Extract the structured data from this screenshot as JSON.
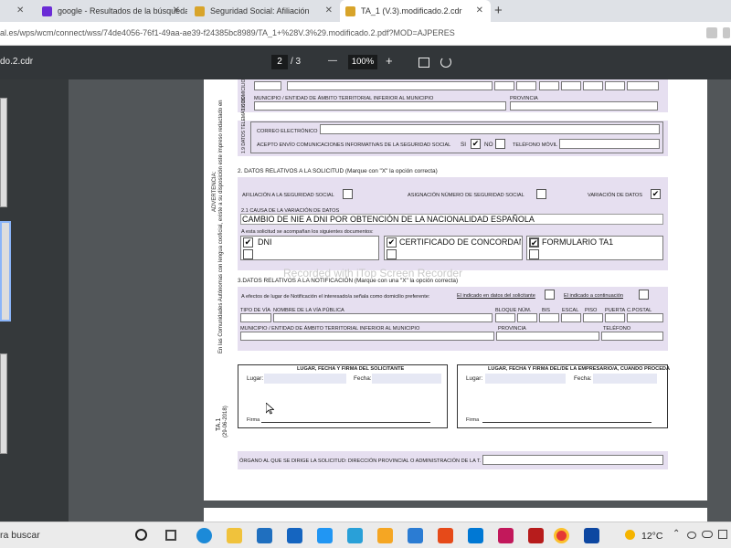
{
  "browser": {
    "tabs": [
      {
        "label": "google - Resultados de la búsqueda",
        "color": "#6a2bd6"
      },
      {
        "label": "Seguridad Social: Afiliación",
        "color": "#d8a42a"
      },
      {
        "label": "TA_1 (V.3).modificado.2.cdr",
        "color": "#d8a42a"
      }
    ],
    "address": "al.es/wps/wcm/connect/wss/74de4056-76f1-49aa-ae39-f24385bc8989/TA_1+%28V.3%29.modificado.2.pdf?MOD=AJPERES"
  },
  "pdf_toolbar": {
    "title": "do.2.cdr",
    "page_current": "2",
    "page_total": "/ 3",
    "zoom": "100%",
    "minus": "—",
    "plus": "+"
  },
  "form": {
    "s18_side": "1.8 DOMICILIO",
    "municipio_label": "MUNICIPIO / ENTIDAD DE ÁMBITO TERRITORIAL INFERIOR AL MUNICIPIO",
    "provincia_label": "PROVINCIA",
    "s19_side": "1.9 DATOS TELEMÁTICOS",
    "correo_label": "CORREO ELECTRÓNICO",
    "acepto_label": "ACEPTO ENVÍO COMUNICACIONES INFORMATIVAS DE LA SEGURIDAD SOCIAL",
    "si": "SI",
    "no": "NO",
    "movil_label": "TELÉFONO MÓVIL",
    "s2_title": "2. DATOS RELATIVOS A LA SOLICITUD (Marque con \"X\" la opción correcta)",
    "afiliacion": "AFILIACIÓN A LA SEGURIDAD SOCIAL",
    "asignacion": "ASIGNACIÓN NÚMERO DE SEGURIDAD SOCIAL",
    "variacion": "VARIACIÓN DE DATOS",
    "causa_label": "2.1 CAUSA DE LA VARIACIÓN DE DATOS",
    "causa_value": "CAMBIO DE NIE A DNI POR OBTENCIÓN DE LA NACIONALIDAD ESPAÑOLA",
    "acompanan": "A esta solicitud se acompañan los siguientes documentos:",
    "doc1": "DNI",
    "doc2": "CERTIFICADO DE CONCORDANCIA",
    "doc3": "FORMULARIO TA1",
    "s3_title": "3.DATOS RELATIVOS A LA NOTIFICACIÓN (Marque con una \"X\" la opción correcta)",
    "efectos": "A efectos de lugar de Notificación el interesado/a señala como domicilio preferente:",
    "indicado_solicitante": "El indicado en datos del solicitante",
    "indicado_continuacion": "El indicado a continuación",
    "cols": [
      "TIPO DE VÍA",
      "NOMBRE DE LA VÍA PÚBLICA",
      "BLOQUE",
      "NÚM.",
      "BIS",
      "ESCAL",
      "PISO",
      "PUERTA",
      "C.POSTAL"
    ],
    "municipio2": "MUNICIPIO / ENTIDAD DE ÁMBITO TERRITORIAL INFERIOR AL MUNICIPIO",
    "provincia2": "PROVINCIA",
    "telefono": "TELÉFONO",
    "firma_sol_title": "LUGAR, FECHA Y FIRMA DEL SOLICITANTE",
    "firma_emp_title": "LUGAR, FECHA Y FIRMA DEL/DE LA EMPRESARIO/A, CUANDO PROCEDA",
    "lugar": "Lugar:",
    "fecha": "Fecha:",
    "firma": "Firma",
    "organo": "ÓRGANO AL QUE SE DIRIGE LA SOLICITUD: DIRECCIÓN PROVINCIAL O ADMINISTRACIÓN DE LA T. G. S. S.:",
    "ta1": "TA.1",
    "ta1_date": "(29-06-2018)",
    "advertencia": "ADVERTENCIA:",
    "side_note": "En las Comunidades Autónomas con lengua cooficial, existe a su disposición este impreso redactado en"
  },
  "watermark": "Recorded with iTop Screen Recorder",
  "taskbar": {
    "search": "ra buscar",
    "temp": "12°C"
  }
}
